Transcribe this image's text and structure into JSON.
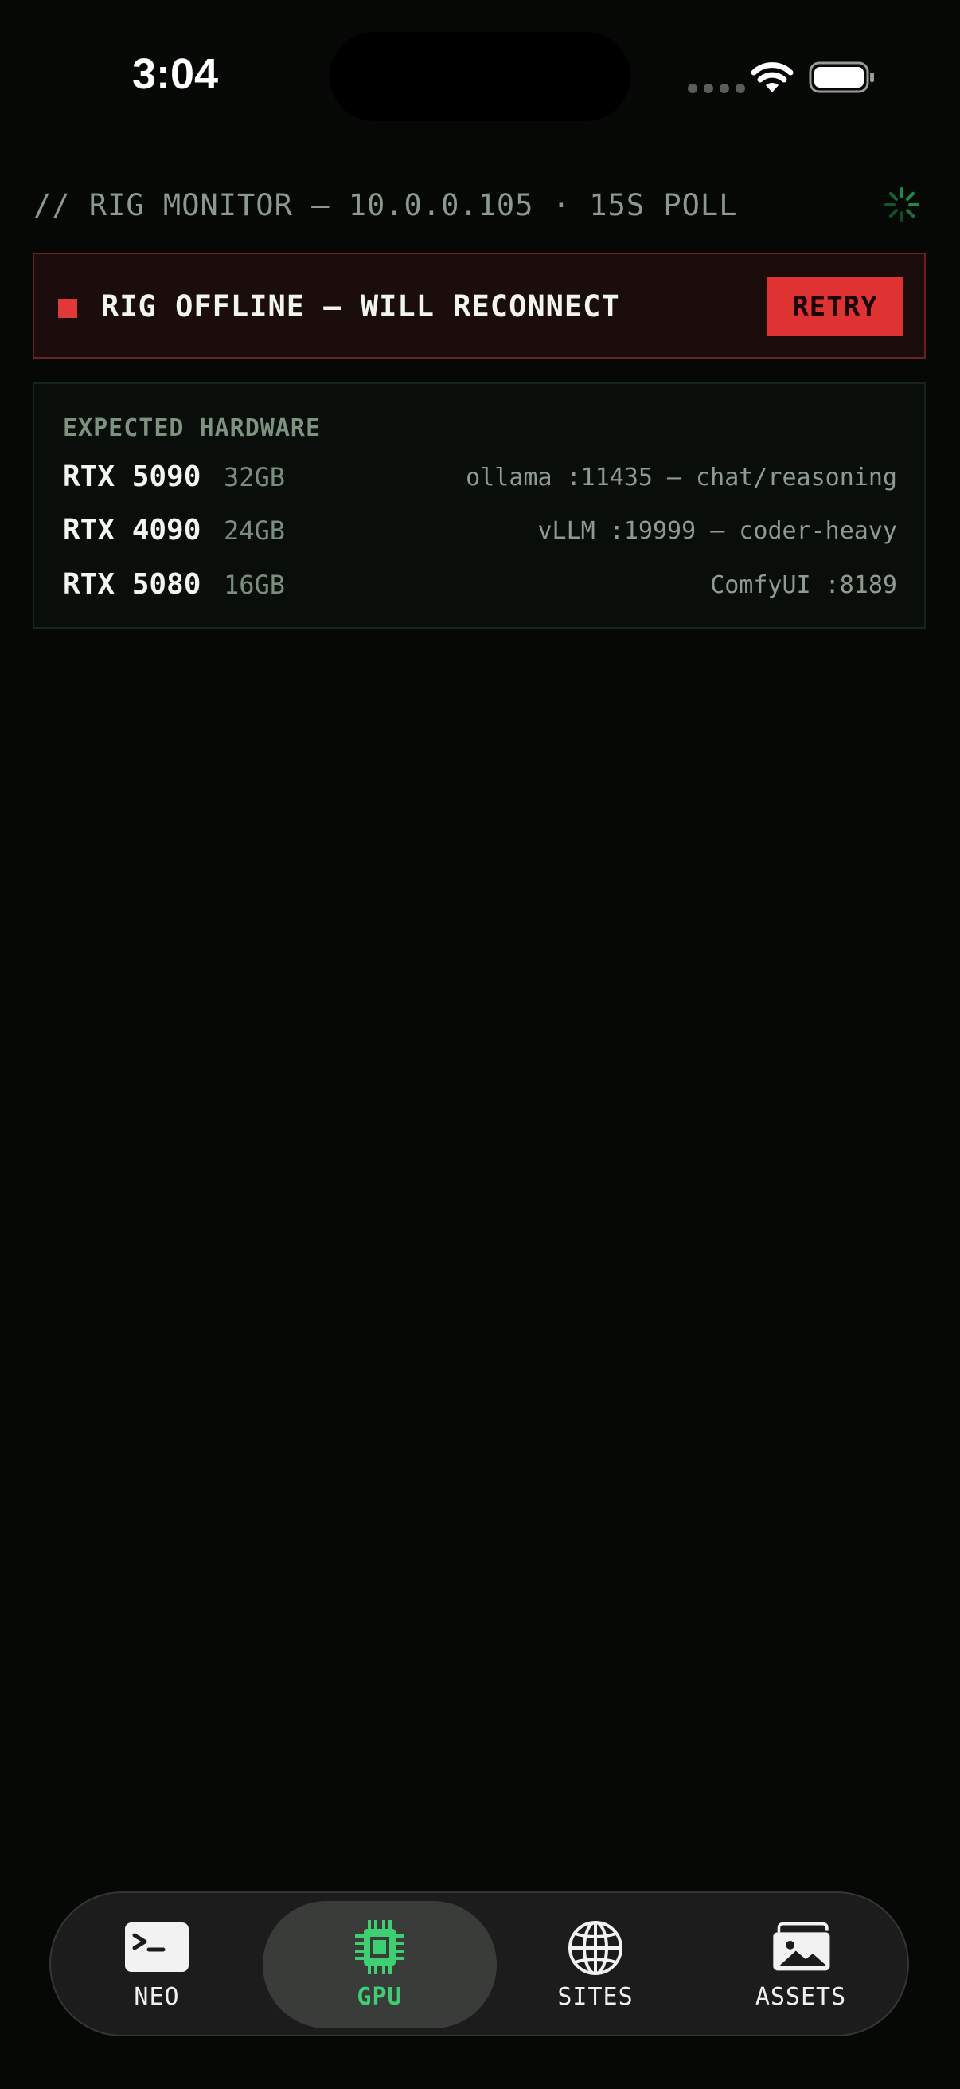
{
  "status_bar": {
    "time": "3:04"
  },
  "header": {
    "title": "// RIG MONITOR — 10.0.0.105 · 15S POLL",
    "loading_icon": "spinner-icon"
  },
  "banner": {
    "message": "RIG OFFLINE — WILL RECONNECT",
    "retry_label": "RETRY",
    "status_color": "#e0393a"
  },
  "hardware": {
    "label": "EXPECTED HARDWARE",
    "rows": [
      {
        "model": "RTX 5090",
        "vram": "32GB",
        "service": "ollama :11435 — chat/reasoning"
      },
      {
        "model": "RTX 4090",
        "vram": "24GB",
        "service": "vLLM :19999 — coder-heavy"
      },
      {
        "model": "RTX 5080",
        "vram": "16GB",
        "service": "ComfyUI :8189"
      }
    ]
  },
  "tabs": [
    {
      "label": "NEO",
      "icon": "terminal-icon",
      "active": false
    },
    {
      "label": "GPU",
      "icon": "cpu-chip-icon",
      "active": true
    },
    {
      "label": "SITES",
      "icon": "globe-icon",
      "active": false
    },
    {
      "label": "ASSETS",
      "icon": "photo-stack-icon",
      "active": false
    }
  ],
  "colors": {
    "background": "#060806",
    "accent_green": "#3fcf73",
    "error_red": "#df3333"
  }
}
